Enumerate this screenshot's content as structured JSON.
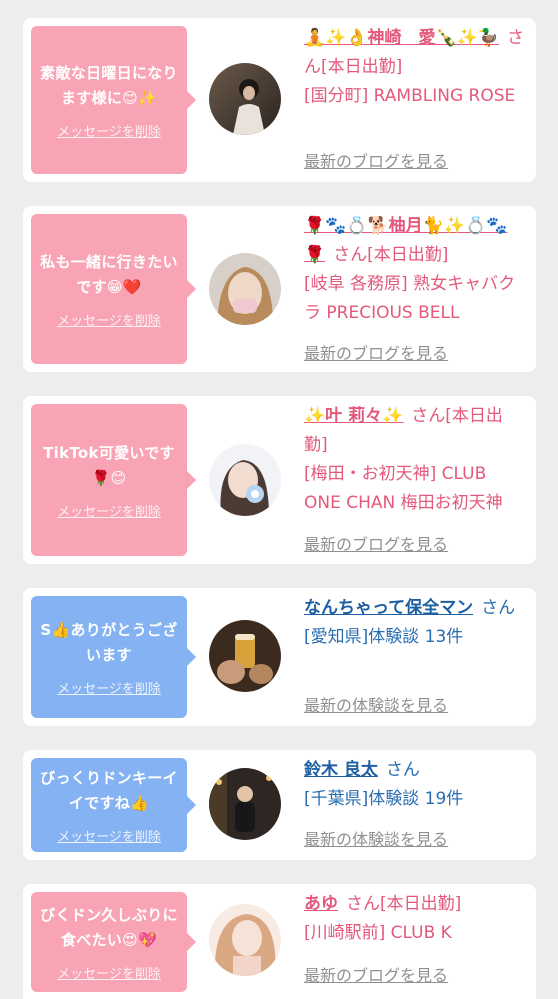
{
  "cards": [
    {
      "message": "素敵な日曜日になります様に😊✨",
      "delete_label": "メッセージを削除",
      "name": "🧘✨👌神崎　愛🍾✨🦆",
      "honorific": "さん",
      "status": "[本日出勤]",
      "shop": "[国分町] RAMBLING ROSE",
      "link_label": "最新のブログを見る",
      "theme": "pink"
    },
    {
      "message": "私も一緒に行きたいです😁❤️",
      "delete_label": "メッセージを削除",
      "name": "🌹🐾💍🐕柚月🐈✨💍🐾🌹",
      "honorific": "さん",
      "status": "[本日出勤]",
      "shop": "[岐阜 各務原]  熟女キャバクラ PRECIOUS BELL",
      "link_label": "最新のブログを見る",
      "theme": "pink"
    },
    {
      "message": "TikTok可愛いです🌹😊",
      "delete_label": "メッセージを削除",
      "name": "✨叶 莉々✨",
      "honorific": "さん",
      "status": "[本日出勤]",
      "shop": "[梅田・お初天神] CLUB ONE CHAN 梅田お初天神",
      "link_label": "最新のブログを見る",
      "theme": "pink"
    },
    {
      "message": "S👍ありがとうございます",
      "delete_label": "メッセージを削除",
      "name": "なんちゃって保全マン",
      "honorific": "さん",
      "status": "",
      "shop": "[愛知県]体験談 13件",
      "link_label": "最新の体験談を見る",
      "theme": "blue"
    },
    {
      "message": "びっくりドンキーイイですね👍",
      "delete_label": "メッセージを削除",
      "name": "鈴木 良太",
      "honorific": "さん",
      "status": "",
      "shop": "[千葉県]体験談 19件",
      "link_label": "最新の体験談を見る",
      "theme": "blue"
    },
    {
      "message": "びくドン久しぶりに食べたい😍💖",
      "delete_label": "メッセージを削除",
      "name": "あゆ",
      "honorific": "さん",
      "status": "[本日出勤]",
      "shop": "[川崎駅前] CLUB K",
      "link_label": "最新のブログを見る",
      "theme": "pink"
    }
  ],
  "colors": {
    "pink_bubble": "#f8a4b4",
    "blue_bubble": "#84b2f2",
    "pink_text": "#e4587b",
    "blue_text": "#2a6db1",
    "link_gray": "#909090",
    "background": "#ededed"
  }
}
